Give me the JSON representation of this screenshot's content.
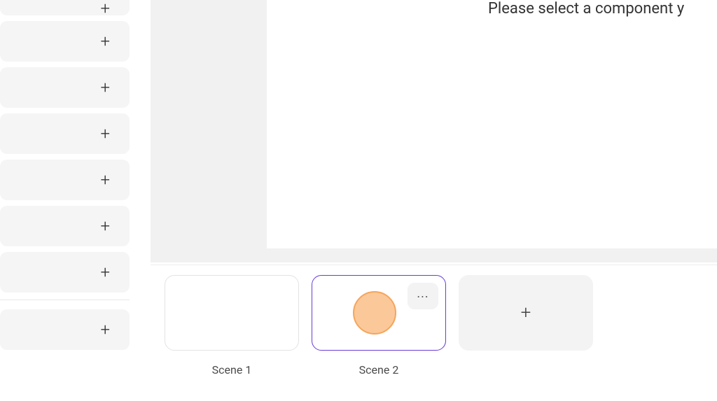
{
  "canvas": {
    "prompt": "Please select a component y"
  },
  "leftPanel": {
    "tileCount": 8
  },
  "timeline": {
    "scenes": [
      {
        "label": "Scene 1",
        "selected": false,
        "hasHighlight": false,
        "hasMore": false
      },
      {
        "label": "Scene 2",
        "selected": true,
        "hasHighlight": true,
        "hasMore": true
      }
    ],
    "moreSymbol": "..."
  },
  "icons": {
    "plus": "+"
  },
  "colors": {
    "selectedBorder": "#6a3bd6",
    "highlightFill": "#fbc89a",
    "highlightStroke": "#f5a55b"
  }
}
